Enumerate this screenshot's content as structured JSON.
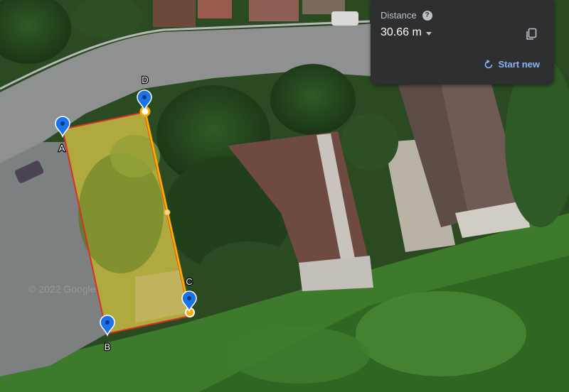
{
  "map": {
    "points": [
      {
        "id": "A",
        "label": "A"
      },
      {
        "id": "B",
        "label": "B"
      },
      {
        "id": "C",
        "label": "C"
      },
      {
        "id": "D",
        "label": "D"
      }
    ],
    "watermark": "© 2022 Google",
    "colors": {
      "area_outline": "#d93025",
      "measure_line": "#f9ab00",
      "marker": "#1a73e8"
    }
  },
  "panel": {
    "title": "Distance",
    "help_icon": "help-icon",
    "distance_value": "30.66 m",
    "copy_icon": "copy-icon",
    "start_new_icon": "refresh-icon",
    "start_new_label": "Start new"
  }
}
